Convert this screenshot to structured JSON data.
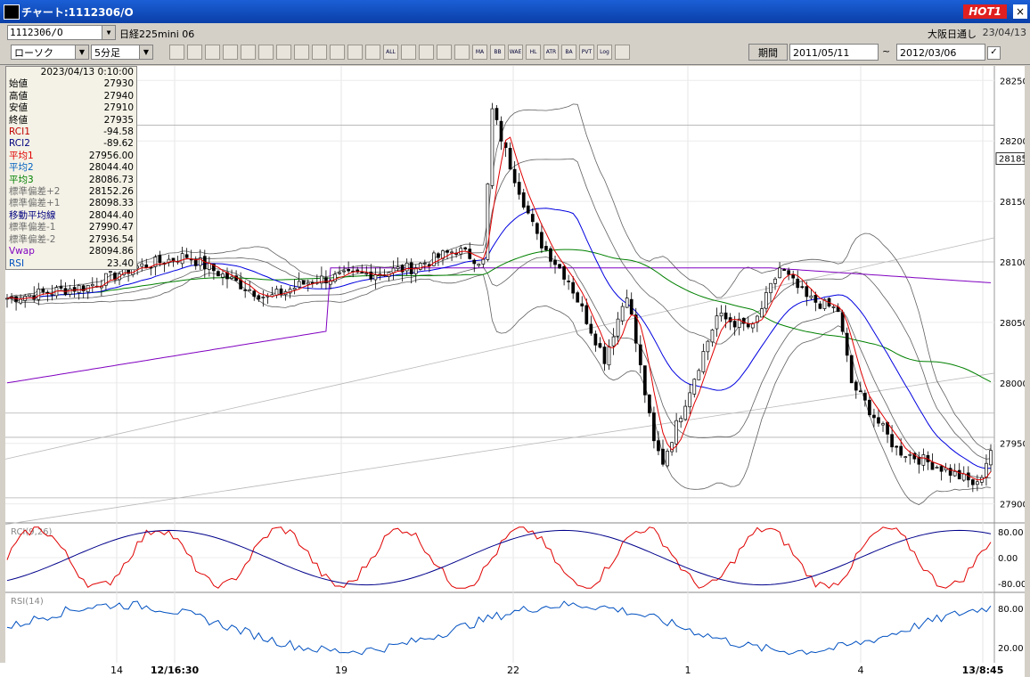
{
  "window": {
    "title": "チャート:1112306/O",
    "hot_badge": "HOT1",
    "close": "×"
  },
  "header": {
    "symbol": "1112306/O",
    "instrument": "日経225mini 06",
    "market": "大阪日通し",
    "date": "23/04/13"
  },
  "toolbar": {
    "chart_type": "ローソク",
    "interval": "5分足",
    "icons": [
      "zoom-icon",
      "grid-icon",
      "download-icon",
      "zoom-out-icon",
      "chart-icon",
      "arrows-icon",
      "warn-icon",
      "pencil-icon",
      "cursor-icon",
      "undo-icon",
      "compare-icon",
      "compare2-icon",
      "all-icon",
      "settings-icon",
      "tools-icon",
      "color-icon",
      "bar-icon",
      "ma-icon",
      "bb-icon",
      "wae-icon",
      "hl-icon",
      "atr-icon",
      "ba-icon",
      "pvt-icon",
      "log-icon",
      "export-icon"
    ],
    "icon_labels": [
      "",
      "",
      "",
      "",
      "",
      "",
      "",
      "",
      "",
      "",
      "",
      "",
      "ALL",
      "",
      "",
      "",
      "",
      "MA",
      "BB",
      "WAE",
      "HL",
      "ATR",
      "BA",
      "PVT",
      "Log",
      ""
    ],
    "period_label": "期間",
    "date_from": "2011/05/11",
    "date_to": "2012/03/06",
    "tilde": "~",
    "check": "✓"
  },
  "info_panel": {
    "datetime": "2023/04/13 0:10:00",
    "rows": [
      {
        "label": "始値",
        "value": "27930",
        "color": "#000000"
      },
      {
        "label": "高値",
        "value": "27940",
        "color": "#000000"
      },
      {
        "label": "安値",
        "value": "27910",
        "color": "#000000"
      },
      {
        "label": "終値",
        "value": "27935",
        "color": "#000000"
      },
      {
        "label": "RCI1",
        "value": "-94.58",
        "color": "#c00000"
      },
      {
        "label": "RCI2",
        "value": "-89.62",
        "color": "#00007f"
      },
      {
        "label": "平均1",
        "value": "27956.00",
        "color": "#e00000"
      },
      {
        "label": "平均2",
        "value": "28044.40",
        "color": "#0060c0"
      },
      {
        "label": "平均3",
        "value": "28086.73",
        "color": "#008000"
      },
      {
        "label": "標準偏差+2",
        "value": "28152.26",
        "color": "#707070"
      },
      {
        "label": "標準偏差+1",
        "value": "28098.33",
        "color": "#707070"
      },
      {
        "label": "移動平均線",
        "value": "28044.40",
        "color": "#000080"
      },
      {
        "label": "標準偏差-1",
        "value": "27990.47",
        "color": "#707070"
      },
      {
        "label": "標準偏差-2",
        "value": "27936.54",
        "color": "#707070"
      },
      {
        "label": "Vwap",
        "value": "28094.86",
        "color": "#8000c0"
      },
      {
        "label": "RSI",
        "value": "23.40",
        "color": "#0050c0"
      }
    ]
  },
  "chart_data": [
    {
      "type": "candlestick",
      "price_axis": {
        "ticks": [
          28250,
          28200,
          28150,
          28100,
          28050,
          28000,
          27950,
          27900
        ],
        "range": [
          27885,
          28262
        ]
      },
      "current_price": "28185",
      "x_labels": [
        "14",
        "12/16:30",
        "19",
        "22",
        "1",
        "4",
        "13/8:45"
      ],
      "bars": 220,
      "trend_segments": [
        {
          "i": 0,
          "p": 28070
        },
        {
          "i": 18,
          "p": 28080
        },
        {
          "i": 28,
          "p": 28095
        },
        {
          "i": 40,
          "p": 28105
        },
        {
          "i": 50,
          "p": 28085
        },
        {
          "i": 58,
          "p": 28070
        },
        {
          "i": 68,
          "p": 28085
        },
        {
          "i": 80,
          "p": 28090
        },
        {
          "i": 90,
          "p": 28095
        },
        {
          "i": 100,
          "p": 28110
        },
        {
          "i": 106,
          "p": 28100
        },
        {
          "i": 108,
          "p": 28225
        },
        {
          "i": 112,
          "p": 28180
        },
        {
          "i": 118,
          "p": 28120
        },
        {
          "i": 125,
          "p": 28085
        },
        {
          "i": 133,
          "p": 28020
        },
        {
          "i": 138,
          "p": 28075
        },
        {
          "i": 144,
          "p": 27950
        },
        {
          "i": 146,
          "p": 27935
        },
        {
          "i": 153,
          "p": 28005
        },
        {
          "i": 158,
          "p": 28055
        },
        {
          "i": 166,
          "p": 28045
        },
        {
          "i": 172,
          "p": 28095
        },
        {
          "i": 178,
          "p": 28070
        },
        {
          "i": 185,
          "p": 28060
        },
        {
          "i": 188,
          "p": 28000
        },
        {
          "i": 198,
          "p": 27945
        },
        {
          "i": 208,
          "p": 27930
        },
        {
          "i": 216,
          "p": 27915
        },
        {
          "i": 219,
          "p": 27945
        }
      ]
    },
    {
      "type": "line",
      "label": "RCI(9,26)",
      "y_ticks": [
        "80.00",
        "0.00",
        "-80.00"
      ],
      "range": [
        -100,
        100
      ]
    },
    {
      "type": "line",
      "label": "RSI(14)",
      "y_ticks": [
        "80.00",
        "20.00"
      ],
      "range": [
        0,
        100
      ]
    }
  ],
  "colors": {
    "ma1": "#e00000",
    "ma2": "#0000e0",
    "ma3": "#008000",
    "vwap": "#8000c0",
    "bands": "#606060",
    "rsi": "#0050c0",
    "rci1": "#e00000",
    "rci2": "#00008b"
  }
}
